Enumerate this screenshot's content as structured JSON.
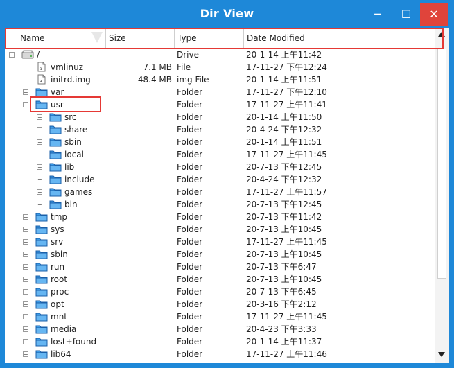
{
  "window": {
    "title": "Dir View"
  },
  "controls": {
    "minimize": "─",
    "maximize": "☐",
    "close": "✕"
  },
  "columns": {
    "name": "Name",
    "size": "Size",
    "type": "Type",
    "date": "Date Modified"
  },
  "rows": [
    {
      "name": "/",
      "size": "",
      "type": "Drive",
      "date": "20-1-14 上午11:42",
      "icon": "drive-icon",
      "level": 0,
      "toggle": "minus"
    },
    {
      "name": "vmlinuz",
      "size": "7.1 MB",
      "type": "File",
      "date": "17-11-27 下午12:24",
      "icon": "file-icon",
      "level": 1,
      "toggle": ""
    },
    {
      "name": "initrd.img",
      "size": "48.4 MB",
      "type": "img File",
      "date": "20-1-14 上午11:51",
      "icon": "file-icon",
      "level": 1,
      "toggle": ""
    },
    {
      "name": "var",
      "size": "",
      "type": "Folder",
      "date": "17-11-27 下午12:10",
      "icon": "folder-icon",
      "level": 1,
      "toggle": "plus"
    },
    {
      "name": "usr",
      "size": "",
      "type": "Folder",
      "date": "17-11-27 上午11:41",
      "icon": "folder-icon",
      "level": 1,
      "toggle": "minus"
    },
    {
      "name": "src",
      "size": "",
      "type": "Folder",
      "date": "20-1-14 上午11:50",
      "icon": "folder-icon",
      "level": 2,
      "toggle": "plus"
    },
    {
      "name": "share",
      "size": "",
      "type": "Folder",
      "date": "20-4-24 下午12:32",
      "icon": "folder-icon",
      "level": 2,
      "toggle": "plus"
    },
    {
      "name": "sbin",
      "size": "",
      "type": "Folder",
      "date": "20-1-14 上午11:51",
      "icon": "folder-icon",
      "level": 2,
      "toggle": "plus"
    },
    {
      "name": "local",
      "size": "",
      "type": "Folder",
      "date": "17-11-27 上午11:45",
      "icon": "folder-icon",
      "level": 2,
      "toggle": "plus"
    },
    {
      "name": "lib",
      "size": "",
      "type": "Folder",
      "date": "20-7-13 下午12:45",
      "icon": "folder-icon",
      "level": 2,
      "toggle": "plus"
    },
    {
      "name": "include",
      "size": "",
      "type": "Folder",
      "date": "20-4-24 下午12:32",
      "icon": "folder-icon",
      "level": 2,
      "toggle": "plus"
    },
    {
      "name": "games",
      "size": "",
      "type": "Folder",
      "date": "17-11-27 上午11:57",
      "icon": "folder-icon",
      "level": 2,
      "toggle": "plus"
    },
    {
      "name": "bin",
      "size": "",
      "type": "Folder",
      "date": "20-7-13 下午12:45",
      "icon": "folder-icon",
      "level": 2,
      "toggle": "plus"
    },
    {
      "name": "tmp",
      "size": "",
      "type": "Folder",
      "date": "20-7-13 下午11:42",
      "icon": "folder-icon",
      "level": 1,
      "toggle": "plus"
    },
    {
      "name": "sys",
      "size": "",
      "type": "Folder",
      "date": "20-7-13 上午10:45",
      "icon": "folder-icon",
      "level": 1,
      "toggle": "plus"
    },
    {
      "name": "srv",
      "size": "",
      "type": "Folder",
      "date": "17-11-27 上午11:45",
      "icon": "folder-icon",
      "level": 1,
      "toggle": "plus"
    },
    {
      "name": "sbin",
      "size": "",
      "type": "Folder",
      "date": "20-7-13 上午10:45",
      "icon": "folder-icon",
      "level": 1,
      "toggle": "plus"
    },
    {
      "name": "run",
      "size": "",
      "type": "Folder",
      "date": "20-7-13 下午6:47",
      "icon": "folder-icon",
      "level": 1,
      "toggle": "plus"
    },
    {
      "name": "root",
      "size": "",
      "type": "Folder",
      "date": "20-7-13 上午10:45",
      "icon": "folder-icon",
      "level": 1,
      "toggle": "plus"
    },
    {
      "name": "proc",
      "size": "",
      "type": "Folder",
      "date": "20-7-13 下午6:45",
      "icon": "folder-icon",
      "level": 1,
      "toggle": "plus"
    },
    {
      "name": "opt",
      "size": "",
      "type": "Folder",
      "date": "20-3-16 下午2:12",
      "icon": "folder-icon",
      "level": 1,
      "toggle": "plus"
    },
    {
      "name": "mnt",
      "size": "",
      "type": "Folder",
      "date": "17-11-27 上午11:45",
      "icon": "folder-icon",
      "level": 1,
      "toggle": "plus"
    },
    {
      "name": "media",
      "size": "",
      "type": "Folder",
      "date": "20-4-23 下午3:33",
      "icon": "folder-icon",
      "level": 1,
      "toggle": "plus"
    },
    {
      "name": "lost+found",
      "size": "",
      "type": "Folder",
      "date": "20-1-14 上午11:37",
      "icon": "folder-icon",
      "level": 1,
      "toggle": "plus"
    },
    {
      "name": "lib64",
      "size": "",
      "type": "Folder",
      "date": "17-11-27 上午11:46",
      "icon": "folder-icon",
      "level": 1,
      "toggle": "plus"
    }
  ],
  "colors": {
    "titlebar": "#1e88d8",
    "close": "#e0443b",
    "highlight": "#e53935",
    "folder": "#1e7fd6"
  }
}
